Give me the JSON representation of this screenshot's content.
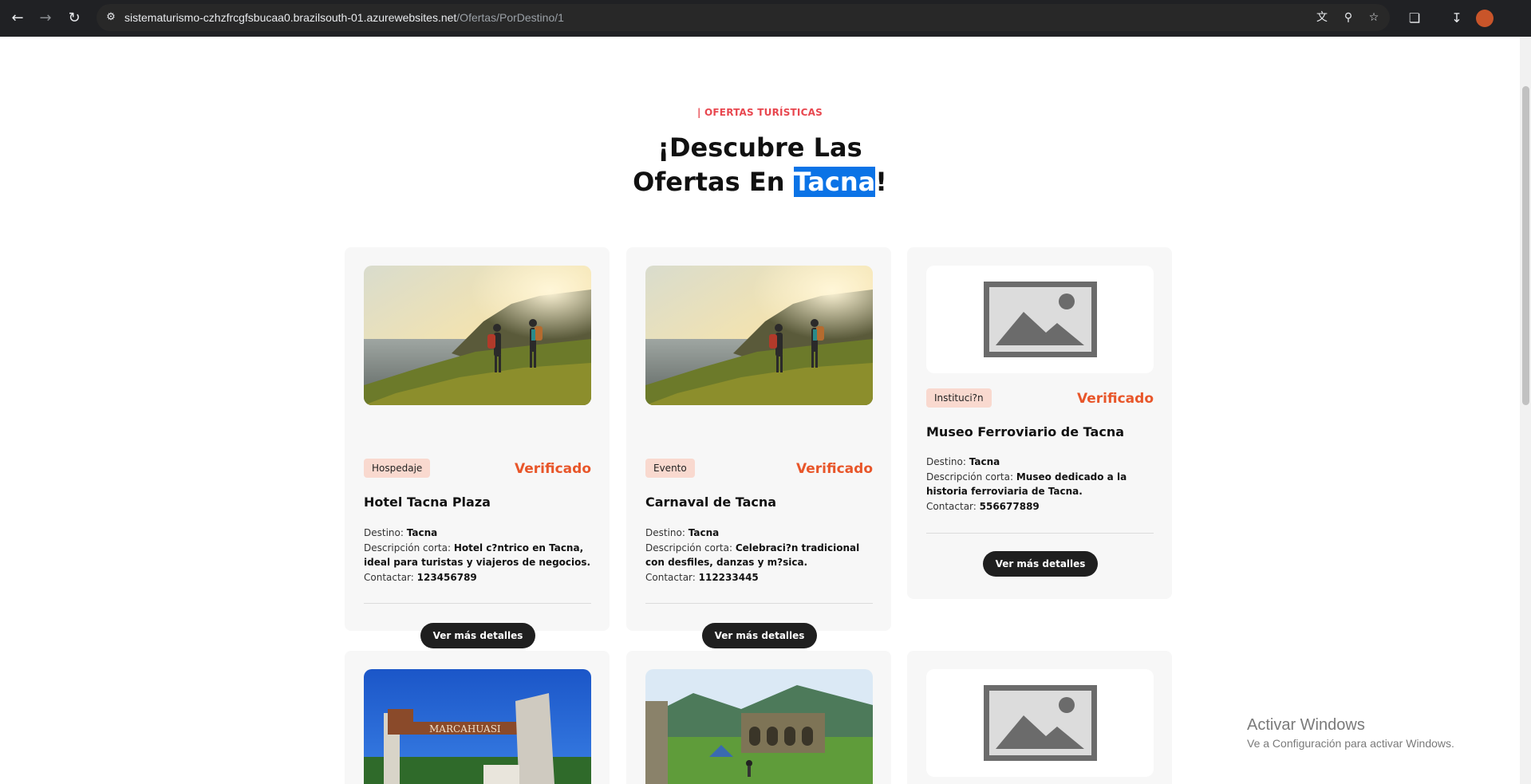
{
  "browser": {
    "url_host": "sistematurismo-czhzfrcgfsbucaa0.brazilsouth-01.azurewebsites.net",
    "url_path": "/Ofertas/PorDestino/1",
    "icons": [
      "back-icon",
      "forward-icon",
      "reload-icon",
      "site-info-icon",
      "translate-icon",
      "zoom-icon",
      "bookmark-star-icon",
      "extensions-icon",
      "download-icon",
      "profile-avatar"
    ]
  },
  "header": {
    "eyebrow": "| OFERTAS TURÍSTICAS",
    "title_line1": "¡Descubre Las",
    "title_line2_prefix": "Ofertas En ",
    "title_highlight": "Tacna",
    "title_suffix": "!"
  },
  "labels": {
    "destino": "Destino: ",
    "descripcion": "Descripción corta: ",
    "contactar": "Contactar: ",
    "verified": "Verificado",
    "details_button": "Ver más detalles"
  },
  "cards": [
    {
      "category": "Hospedaje",
      "verified": "Verificado",
      "name": "Hotel Tacna Plaza",
      "destino": "Tacna",
      "descripcion": "Hotel c?ntrico en Tacna, ideal para turistas y viajeros de negocios.",
      "contacto": "123456789",
      "image": "hikers-coast-photo",
      "button": "Ver más detalles"
    },
    {
      "category": "Evento",
      "verified": "Verificado",
      "name": "Carnaval de Tacna",
      "destino": "Tacna",
      "descripcion": "Celebraci?n tradicional con desfiles, danzas y m?sica.",
      "contacto": "112233445",
      "image": "hikers-coast-photo",
      "button": "Ver más detalles"
    },
    {
      "category": "Instituci?n",
      "verified": "Verificado",
      "name": "Museo Ferroviario de Tacna",
      "destino": "Tacna",
      "descripcion": "Museo dedicado a la historia ferroviaria de Tacna.",
      "contacto": "556677889",
      "image": "image-placeholder",
      "button": "Ver más detalles"
    }
  ],
  "second_row_images": {
    "first": "marcahuasi-arch-photo",
    "first_sign": "MARCAHUASI",
    "second": "stone-ruins-camp-photo",
    "third": "image-placeholder"
  },
  "watermark": {
    "title": "Activar Windows",
    "subtitle": "Ve a Configuración para activar Windows."
  },
  "colors": {
    "accent_red": "#e8474f",
    "verified_orange": "#e8562a",
    "badge_bg": "#f9d9cf",
    "button_bg": "#1f1f1f",
    "selection_blue": "#0b73e6"
  }
}
